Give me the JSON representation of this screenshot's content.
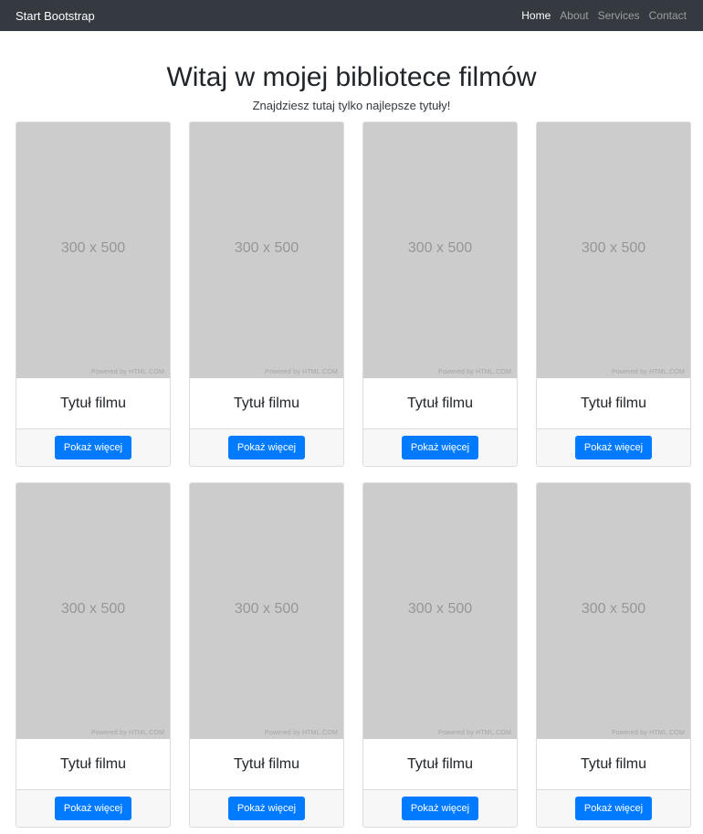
{
  "navbar": {
    "brand": "Start Bootstrap",
    "links": [
      {
        "label": "Home",
        "active": true
      },
      {
        "label": "About"
      },
      {
        "label": "Services"
      },
      {
        "label": "Contact"
      }
    ]
  },
  "header": {
    "title": "Witaj w mojej bibliotece filmów",
    "subtitle": "Znajdziesz tutaj tylko najlepsze tytuły!"
  },
  "cards": [
    {
      "poster_label": "300 x 500",
      "poster_credit": "Powered by HTML.COM",
      "title": "Tytuł filmu",
      "button": "Pokaż więcej"
    },
    {
      "poster_label": "300 x 500",
      "poster_credit": "Powered by HTML.COM",
      "title": "Tytuł filmu",
      "button": "Pokaż więcej"
    },
    {
      "poster_label": "300 x 500",
      "poster_credit": "Powered by HTML.COM",
      "title": "Tytuł filmu",
      "button": "Pokaż więcej"
    },
    {
      "poster_label": "300 x 500",
      "poster_credit": "Powered by HTML.COM",
      "title": "Tytuł filmu",
      "button": "Pokaż więcej"
    },
    {
      "poster_label": "300 x 500",
      "poster_credit": "Powered by HTML.COM",
      "title": "Tytuł filmu",
      "button": "Pokaż więcej"
    },
    {
      "poster_label": "300 x 500",
      "poster_credit": "Powered by HTML.COM",
      "title": "Tytuł filmu",
      "button": "Pokaż więcej"
    },
    {
      "poster_label": "300 x 500",
      "poster_credit": "Powered by HTML.COM",
      "title": "Tytuł filmu",
      "button": "Pokaż więcej"
    },
    {
      "poster_label": "300 x 500",
      "poster_credit": "Powered by HTML.COM",
      "title": "Tytuł filmu",
      "button": "Pokaż więcej"
    }
  ],
  "colors": {
    "navbar_bg": "#343a40",
    "button_primary": "#007bff",
    "poster_placeholder": "#cccccc"
  }
}
